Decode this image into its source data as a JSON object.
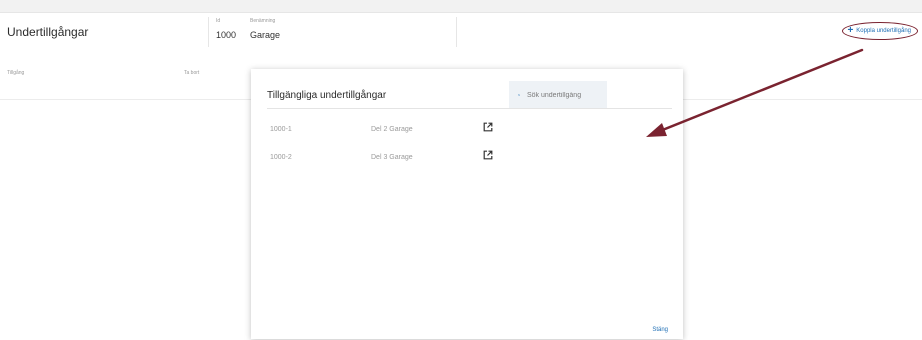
{
  "header": {
    "title": "Undertillgångar",
    "id_label": "Id",
    "id_value": "1000",
    "name_label": "Benämning",
    "name_value": "Garage",
    "add_button_label": "Koppla undertillgång"
  },
  "list": {
    "col_asset": "Tillgång",
    "col_remove": "Ta bort"
  },
  "modal": {
    "title": "Tillgängliga undertillgångar",
    "search_placeholder": "Sök undertillgång",
    "rows": [
      {
        "id": "1000-1",
        "name": "Del 2 Garage"
      },
      {
        "id": "1000-2",
        "name": "Del 3 Garage"
      }
    ],
    "close_label": "Stäng"
  },
  "colors": {
    "accent": "#1f6fb5",
    "annotation": "#7a2330"
  },
  "icons": {
    "add": "plus-icon",
    "search": "search-icon",
    "open": "open-external-icon"
  }
}
